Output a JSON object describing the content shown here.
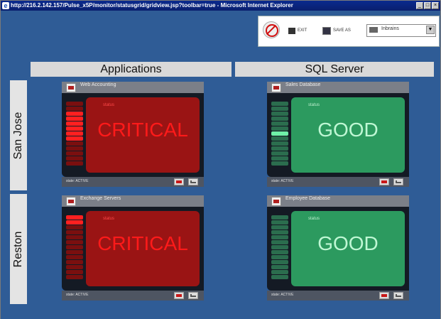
{
  "window": {
    "title": "http://216.2.142.157/Pulse_x5P/monitor/statusgrid/gridview.jsp?toolbar=true - Microsoft Internet Explorer"
  },
  "toolbar": {
    "exit_label": "EXIT",
    "save_label": "SAVE AS",
    "view_select_value": "Inbrains"
  },
  "columns": [
    "Applications",
    "SQL Server"
  ],
  "rows": [
    "San Jose",
    "Reston"
  ],
  "panels": [
    {
      "title": "Web Accounting",
      "status_small": "status",
      "status": "CRITICAL",
      "footer": "state: ACTIVE"
    },
    {
      "title": "Sales Database",
      "status_small": "status",
      "status": "GOOD",
      "footer": "state: ACTIVE"
    },
    {
      "title": "Exchange Servers",
      "status_small": "status",
      "status": "CRITICAL",
      "footer": "state: ACTIVE"
    },
    {
      "title": "Employee Database",
      "status_small": "status",
      "status": "GOOD",
      "footer": "state: ACTIVE"
    }
  ],
  "colors": {
    "background": "#2f5c96",
    "critical": "#9a1414",
    "good": "#2c9a5f"
  }
}
